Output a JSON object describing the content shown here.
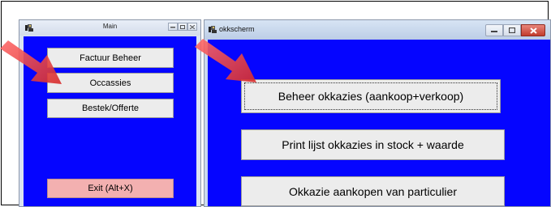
{
  "colors": {
    "client_blue": "#0505ff",
    "button_face": "#ececec",
    "exit_button": "#f3b0b0",
    "arrow_red": "#e03a3a",
    "close_red": "#c9453a"
  },
  "main_window": {
    "title": "Main",
    "icon": "app-icon",
    "buttons": {
      "factuur": "Factuur Beheer",
      "occassies": "Occassies",
      "bestek": "Bestek/Offerte",
      "exit": "Exit   (Alt+X)"
    }
  },
  "okk_window": {
    "title": "okkscherm",
    "icon": "app-icon",
    "buttons": {
      "beheer": "Beheer okkazies (aankoop+verkoop)",
      "print": "Print  lijst okkazies in stock + waarde",
      "aankopen": "Okkazie aankopen van particulier"
    }
  },
  "annotations": {
    "arrow_icon": "red-pointer-arrow"
  }
}
